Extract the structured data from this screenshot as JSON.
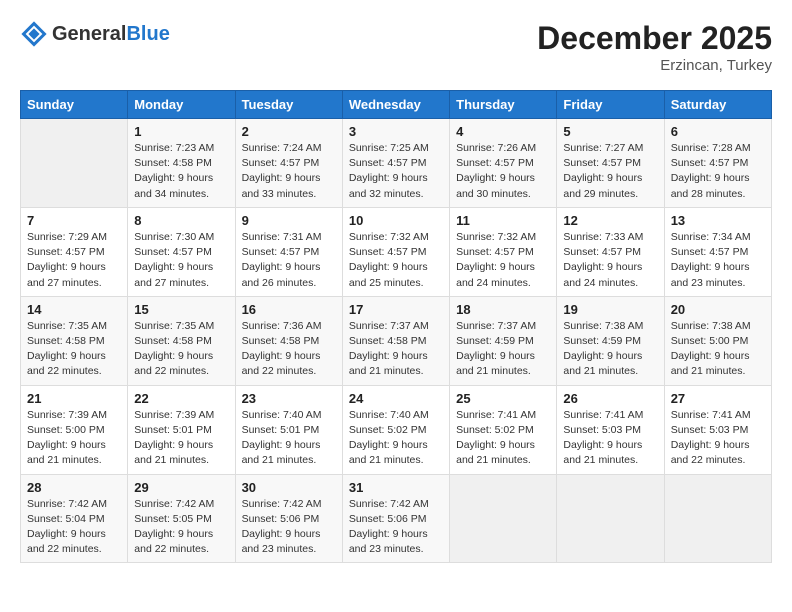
{
  "header": {
    "logo_general": "General",
    "logo_blue": "Blue",
    "month": "December 2025",
    "location": "Erzincan, Turkey"
  },
  "weekdays": [
    "Sunday",
    "Monday",
    "Tuesday",
    "Wednesday",
    "Thursday",
    "Friday",
    "Saturday"
  ],
  "weeks": [
    [
      {
        "day": "",
        "sunrise": "",
        "sunset": "",
        "daylight": "",
        "empty": true
      },
      {
        "day": "1",
        "sunrise": "Sunrise: 7:23 AM",
        "sunset": "Sunset: 4:58 PM",
        "daylight": "Daylight: 9 hours and 34 minutes."
      },
      {
        "day": "2",
        "sunrise": "Sunrise: 7:24 AM",
        "sunset": "Sunset: 4:57 PM",
        "daylight": "Daylight: 9 hours and 33 minutes."
      },
      {
        "day": "3",
        "sunrise": "Sunrise: 7:25 AM",
        "sunset": "Sunset: 4:57 PM",
        "daylight": "Daylight: 9 hours and 32 minutes."
      },
      {
        "day": "4",
        "sunrise": "Sunrise: 7:26 AM",
        "sunset": "Sunset: 4:57 PM",
        "daylight": "Daylight: 9 hours and 30 minutes."
      },
      {
        "day": "5",
        "sunrise": "Sunrise: 7:27 AM",
        "sunset": "Sunset: 4:57 PM",
        "daylight": "Daylight: 9 hours and 29 minutes."
      },
      {
        "day": "6",
        "sunrise": "Sunrise: 7:28 AM",
        "sunset": "Sunset: 4:57 PM",
        "daylight": "Daylight: 9 hours and 28 minutes."
      }
    ],
    [
      {
        "day": "7",
        "sunrise": "Sunrise: 7:29 AM",
        "sunset": "Sunset: 4:57 PM",
        "daylight": "Daylight: 9 hours and 27 minutes."
      },
      {
        "day": "8",
        "sunrise": "Sunrise: 7:30 AM",
        "sunset": "Sunset: 4:57 PM",
        "daylight": "Daylight: 9 hours and 27 minutes."
      },
      {
        "day": "9",
        "sunrise": "Sunrise: 7:31 AM",
        "sunset": "Sunset: 4:57 PM",
        "daylight": "Daylight: 9 hours and 26 minutes."
      },
      {
        "day": "10",
        "sunrise": "Sunrise: 7:32 AM",
        "sunset": "Sunset: 4:57 PM",
        "daylight": "Daylight: 9 hours and 25 minutes."
      },
      {
        "day": "11",
        "sunrise": "Sunrise: 7:32 AM",
        "sunset": "Sunset: 4:57 PM",
        "daylight": "Daylight: 9 hours and 24 minutes."
      },
      {
        "day": "12",
        "sunrise": "Sunrise: 7:33 AM",
        "sunset": "Sunset: 4:57 PM",
        "daylight": "Daylight: 9 hours and 24 minutes."
      },
      {
        "day": "13",
        "sunrise": "Sunrise: 7:34 AM",
        "sunset": "Sunset: 4:57 PM",
        "daylight": "Daylight: 9 hours and 23 minutes."
      }
    ],
    [
      {
        "day": "14",
        "sunrise": "Sunrise: 7:35 AM",
        "sunset": "Sunset: 4:58 PM",
        "daylight": "Daylight: 9 hours and 22 minutes."
      },
      {
        "day": "15",
        "sunrise": "Sunrise: 7:35 AM",
        "sunset": "Sunset: 4:58 PM",
        "daylight": "Daylight: 9 hours and 22 minutes."
      },
      {
        "day": "16",
        "sunrise": "Sunrise: 7:36 AM",
        "sunset": "Sunset: 4:58 PM",
        "daylight": "Daylight: 9 hours and 22 minutes."
      },
      {
        "day": "17",
        "sunrise": "Sunrise: 7:37 AM",
        "sunset": "Sunset: 4:58 PM",
        "daylight": "Daylight: 9 hours and 21 minutes."
      },
      {
        "day": "18",
        "sunrise": "Sunrise: 7:37 AM",
        "sunset": "Sunset: 4:59 PM",
        "daylight": "Daylight: 9 hours and 21 minutes."
      },
      {
        "day": "19",
        "sunrise": "Sunrise: 7:38 AM",
        "sunset": "Sunset: 4:59 PM",
        "daylight": "Daylight: 9 hours and 21 minutes."
      },
      {
        "day": "20",
        "sunrise": "Sunrise: 7:38 AM",
        "sunset": "Sunset: 5:00 PM",
        "daylight": "Daylight: 9 hours and 21 minutes."
      }
    ],
    [
      {
        "day": "21",
        "sunrise": "Sunrise: 7:39 AM",
        "sunset": "Sunset: 5:00 PM",
        "daylight": "Daylight: 9 hours and 21 minutes."
      },
      {
        "day": "22",
        "sunrise": "Sunrise: 7:39 AM",
        "sunset": "Sunset: 5:01 PM",
        "daylight": "Daylight: 9 hours and 21 minutes."
      },
      {
        "day": "23",
        "sunrise": "Sunrise: 7:40 AM",
        "sunset": "Sunset: 5:01 PM",
        "daylight": "Daylight: 9 hours and 21 minutes."
      },
      {
        "day": "24",
        "sunrise": "Sunrise: 7:40 AM",
        "sunset": "Sunset: 5:02 PM",
        "daylight": "Daylight: 9 hours and 21 minutes."
      },
      {
        "day": "25",
        "sunrise": "Sunrise: 7:41 AM",
        "sunset": "Sunset: 5:02 PM",
        "daylight": "Daylight: 9 hours and 21 minutes."
      },
      {
        "day": "26",
        "sunrise": "Sunrise: 7:41 AM",
        "sunset": "Sunset: 5:03 PM",
        "daylight": "Daylight: 9 hours and 21 minutes."
      },
      {
        "day": "27",
        "sunrise": "Sunrise: 7:41 AM",
        "sunset": "Sunset: 5:03 PM",
        "daylight": "Daylight: 9 hours and 22 minutes."
      }
    ],
    [
      {
        "day": "28",
        "sunrise": "Sunrise: 7:42 AM",
        "sunset": "Sunset: 5:04 PM",
        "daylight": "Daylight: 9 hours and 22 minutes."
      },
      {
        "day": "29",
        "sunrise": "Sunrise: 7:42 AM",
        "sunset": "Sunset: 5:05 PM",
        "daylight": "Daylight: 9 hours and 22 minutes."
      },
      {
        "day": "30",
        "sunrise": "Sunrise: 7:42 AM",
        "sunset": "Sunset: 5:06 PM",
        "daylight": "Daylight: 9 hours and 23 minutes."
      },
      {
        "day": "31",
        "sunrise": "Sunrise: 7:42 AM",
        "sunset": "Sunset: 5:06 PM",
        "daylight": "Daylight: 9 hours and 23 minutes."
      },
      {
        "day": "",
        "sunrise": "",
        "sunset": "",
        "daylight": "",
        "empty": true
      },
      {
        "day": "",
        "sunrise": "",
        "sunset": "",
        "daylight": "",
        "empty": true
      },
      {
        "day": "",
        "sunrise": "",
        "sunset": "",
        "daylight": "",
        "empty": true
      }
    ]
  ]
}
